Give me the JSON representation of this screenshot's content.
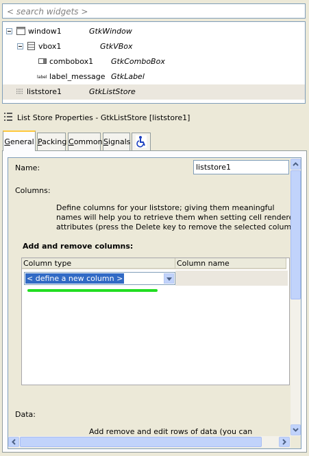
{
  "search": {
    "placeholder": "< search widgets >"
  },
  "tree": {
    "rows": [
      {
        "name": "window1",
        "type": "GtkWindow"
      },
      {
        "name": "vbox1",
        "type": "GtkVBox"
      },
      {
        "name": "combobox1",
        "type": "GtkComboBox"
      },
      {
        "name": "label_message",
        "type": "GtkLabel"
      },
      {
        "name": "liststore1",
        "type": "GtkListStore"
      }
    ]
  },
  "properties": {
    "title": "List Store Properties - GtkListStore [liststore1]",
    "tabs": [
      {
        "label": "General",
        "mnemonic": "G",
        "rest": "eneral"
      },
      {
        "label": "Packing",
        "mnemonic": "P",
        "rest": "acking"
      },
      {
        "label": "Common",
        "mnemonic": "C",
        "rest": "ommon"
      },
      {
        "label": "Signals",
        "mnemonic": "S",
        "rest": "ignals"
      }
    ],
    "accessibility_icon": "wheelchair-icon",
    "name_label": "Name:",
    "name_value": "liststore1",
    "columns_label": "Columns:",
    "columns_desc": [
      "Define columns for your liststore; giving them meaningful",
      "names will help you to retrieve them when setting cell renderer",
      "attributes (press the Delete key to remove the selected column)"
    ],
    "section_title": "Add and remove columns:",
    "col_headers": [
      "Column type",
      "Column name"
    ],
    "combo_value": "< define a new column >",
    "data_label": "Data:",
    "data_desc": "Add remove and edit rows of data (you can"
  },
  "colors": {
    "selection": "#316ac5",
    "highlight": "#22dd22",
    "tab_accent": "#ffc83c"
  }
}
